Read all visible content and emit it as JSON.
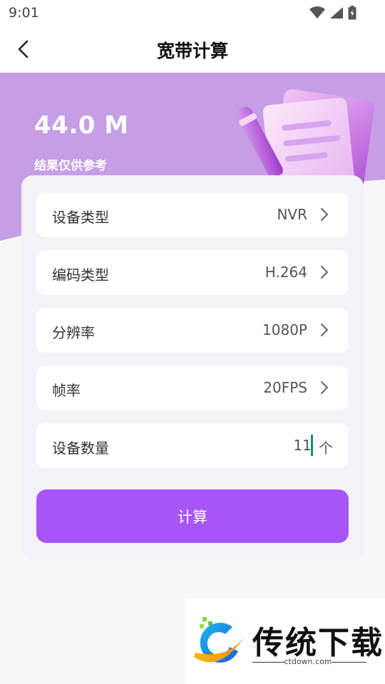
{
  "status_bar": {
    "time": "9:01",
    "icons": [
      "wifi-icon",
      "signal-icon",
      "battery-icon"
    ]
  },
  "nav": {
    "back_icon": "chevron-left-icon",
    "title": "宽带计算"
  },
  "result": {
    "value": "44.0 M",
    "note": "结果仅供参考"
  },
  "form": {
    "rows": [
      {
        "label": "设备类型",
        "value": "NVR"
      },
      {
        "label": "编码类型",
        "value": "H.264"
      },
      {
        "label": "分辨率",
        "value": "1080P"
      },
      {
        "label": "帧率",
        "value": "20FPS"
      }
    ],
    "quantity": {
      "label": "设备数量",
      "value": "11",
      "unit": "个"
    },
    "submit_label": "计算"
  },
  "watermark": {
    "brand": "传统下载",
    "domain": "ctdown.com"
  },
  "colors": {
    "accent": "#a855f7",
    "hero_purple": "#c59ee6",
    "card_bg": "#f2f2f7",
    "caret": "#0a8f73"
  }
}
